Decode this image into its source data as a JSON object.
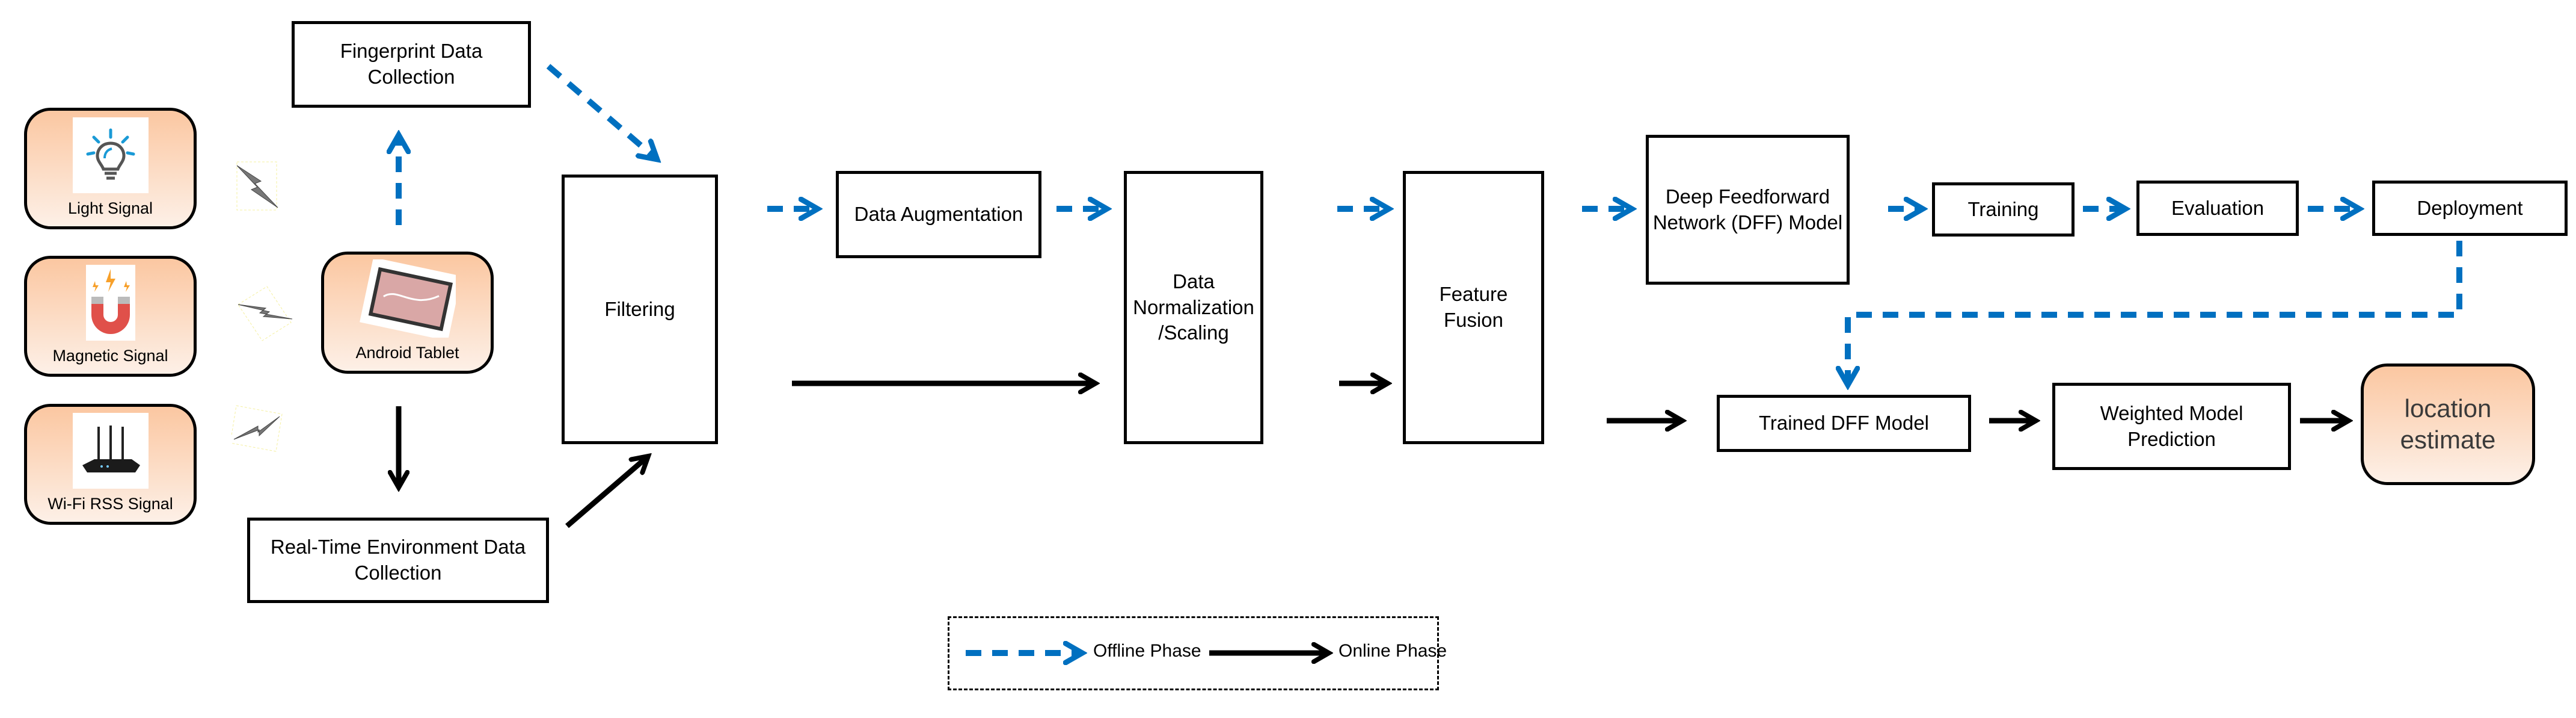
{
  "colors": {
    "offline": "#0070c0",
    "online": "#000000",
    "node_fill_top": "#fbc7a1",
    "node_fill_bottom": "#fdf0e7"
  },
  "sources": [
    {
      "label": "Light Signal",
      "icon": "lightbulb-icon"
    },
    {
      "label": "Magnetic Signal",
      "icon": "magnet-icon"
    },
    {
      "label": "Wi-Fi RSS Signal",
      "icon": "router-icon"
    }
  ],
  "device": {
    "label": "Android Tablet",
    "icon": "tablet-icon"
  },
  "nodes": {
    "fingerprint": "Fingerprint Data Collection",
    "realtime": "Real-Time Environment Data Collection",
    "filtering": "Filtering",
    "augmentation": "Data Augmentation",
    "normalization": "Data Normalization /Scaling",
    "fusion": "Feature Fusion",
    "dff": "Deep Feedforward Network (DFF) Model",
    "training": "Training",
    "evaluation": "Evaluation",
    "deployment": "Deployment",
    "trained": "Trained DFF Model",
    "weighted": "Weighted Model Prediction",
    "location": "location estimate"
  },
  "legend": {
    "offline": "Offline Phase",
    "online": "Online Phase"
  }
}
